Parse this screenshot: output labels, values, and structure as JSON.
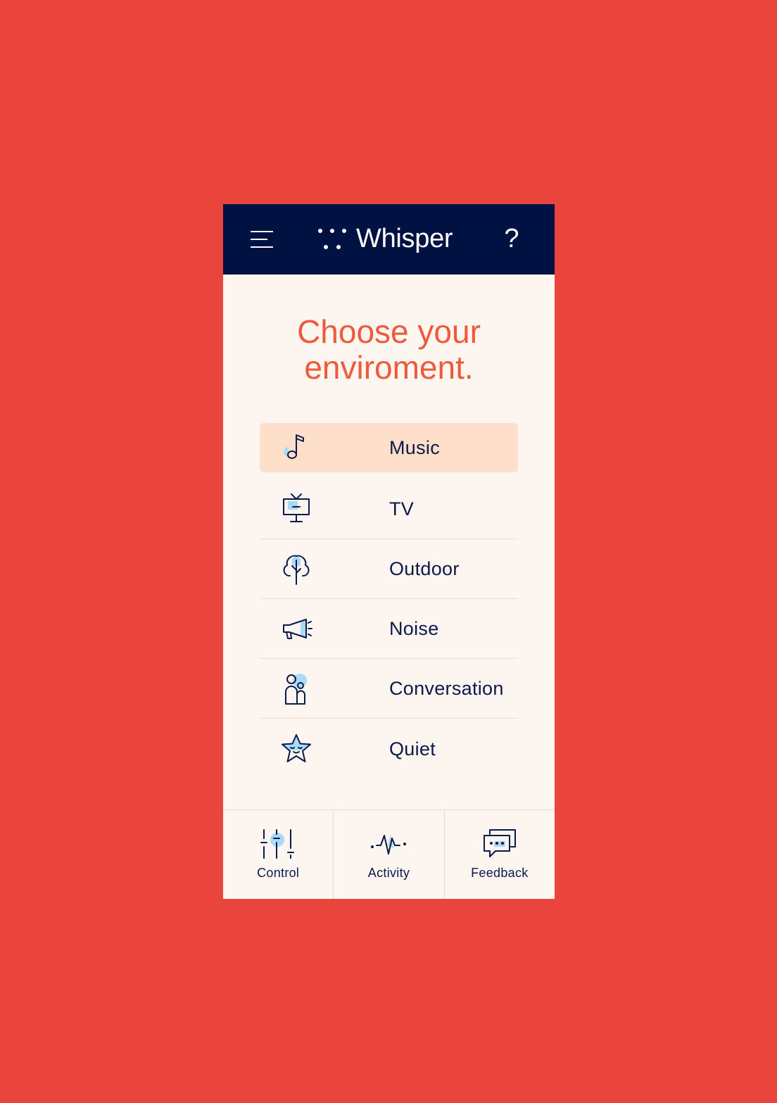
{
  "app": {
    "name": "Whisper"
  },
  "header": {
    "help_label": "?"
  },
  "headline": "Choose your enviroment.",
  "environments": [
    {
      "label": "Music",
      "icon": "music-note-icon",
      "selected": true
    },
    {
      "label": "TV",
      "icon": "tv-icon",
      "selected": false
    },
    {
      "label": "Outdoor",
      "icon": "tree-icon",
      "selected": false
    },
    {
      "label": "Noise",
      "icon": "megaphone-icon",
      "selected": false
    },
    {
      "label": "Conversation",
      "icon": "people-icon",
      "selected": false
    },
    {
      "label": "Quiet",
      "icon": "sleeping-star-icon",
      "selected": false
    }
  ],
  "bottom_nav": [
    {
      "label": "Control",
      "icon": "sliders-icon"
    },
    {
      "label": "Activity",
      "icon": "pulse-icon"
    },
    {
      "label": "Feedback",
      "icon": "chat-bubbles-icon"
    }
  ],
  "colors": {
    "background": "#e9453d",
    "header": "#001242",
    "panel": "#fdf5ef",
    "accent": "#ef5a3a",
    "selected_row": "#fedfca",
    "icon_highlight": "#a9dbf7",
    "text": "#0b1a4a"
  }
}
